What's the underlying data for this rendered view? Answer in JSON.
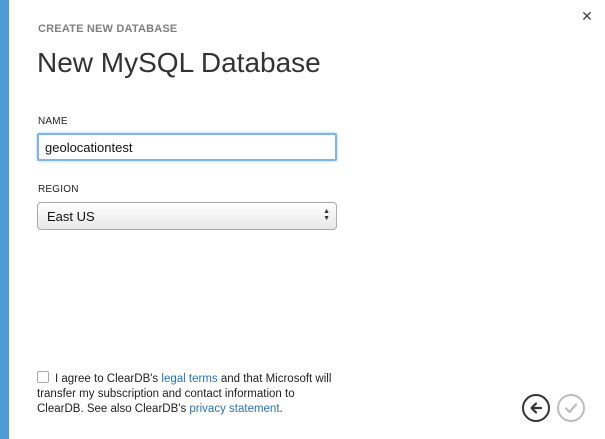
{
  "dialog": {
    "subtitle": "CREATE NEW DATABASE",
    "title": "New MySQL Database",
    "close_icon": "close-icon"
  },
  "form": {
    "name_label": "NAME",
    "name_value": "geolocationtest",
    "region_label": "REGION",
    "region_value": "East US"
  },
  "agreement": {
    "checked": false,
    "text_part1": "I agree to ClearDB's ",
    "legal_terms_link": "legal terms",
    "text_part2": " and that Microsoft will transfer my subscription and contact information to ClearDB. See also ClearDB's ",
    "privacy_link": "privacy statement",
    "text_part3": "."
  },
  "navigation": {
    "back_icon": "back-arrow-icon",
    "ok_icon": "checkmark-icon"
  },
  "colors": {
    "accent_bar": "#4d9bd8",
    "link": "#2a73b8",
    "input_focus_border": "#7fb5e6"
  }
}
